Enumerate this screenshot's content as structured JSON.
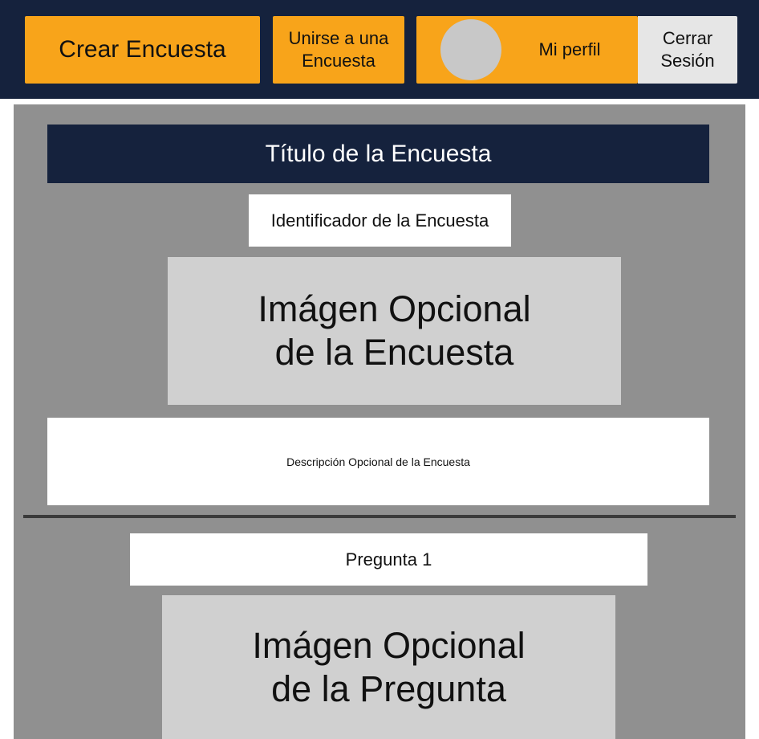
{
  "header": {
    "create_survey_label": "Crear Encuesta",
    "join_survey_label": "Unirse a una\nEncuesta",
    "profile_label": "Mi perfil",
    "logout_label": "Cerrar\nSesión"
  },
  "survey": {
    "title": "Título de la Encuesta",
    "identifier": "Identificador de la Encuesta",
    "image_placeholder": "Imágen Opcional\nde la Encuesta",
    "description": "Descripción Opcional de la Encuesta"
  },
  "question": {
    "label": "Pregunta 1",
    "image_placeholder": "Imágen Opcional\nde la Pregunta"
  },
  "colors": {
    "navy": "#15223d",
    "orange": "#f8a41a",
    "panel_gray": "#909090",
    "placeholder_gray": "#d0d0d0",
    "logout_bg": "#e6e6e6"
  }
}
